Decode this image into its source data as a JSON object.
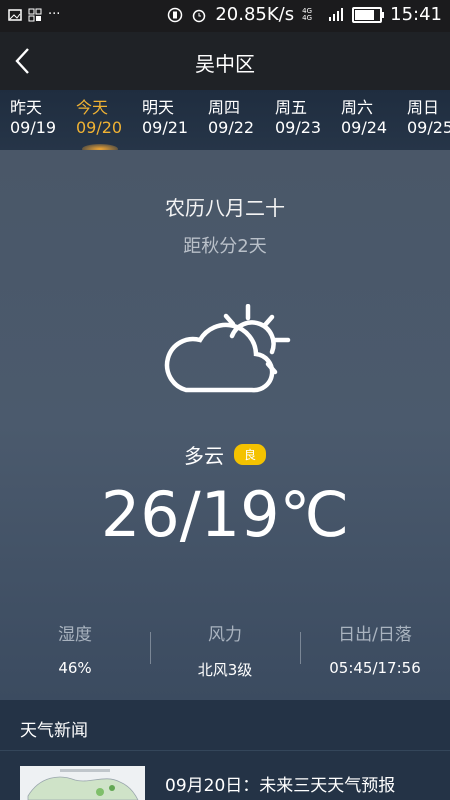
{
  "status_bar": {
    "speed": "20.85K/s",
    "network": "4G 4G",
    "time": "15:41",
    "battery_level": 0.85
  },
  "header": {
    "title": "吴中区"
  },
  "date_strip": {
    "items": [
      {
        "weekday": "昨天",
        "date": "09/19"
      },
      {
        "weekday": "今天",
        "date": "09/20"
      },
      {
        "weekday": "明天",
        "date": "09/21"
      },
      {
        "weekday": "周四",
        "date": "09/22"
      },
      {
        "weekday": "周五",
        "date": "09/23"
      },
      {
        "weekday": "周六",
        "date": "09/24"
      },
      {
        "weekday": "周日",
        "date": "09/25"
      }
    ],
    "active_index": 1
  },
  "weather": {
    "lunar_date": "农历八月二十",
    "solar_term": "距秋分2天",
    "icon": "partly-cloudy-icon",
    "condition": "多云",
    "aqi_label": "良",
    "temperature": "26/19℃"
  },
  "stats": [
    {
      "label": "湿度",
      "value": "46%"
    },
    {
      "label": "风力",
      "value": "北风3级"
    },
    {
      "label": "日出/日落",
      "value": "05:45/17:56"
    }
  ],
  "news": {
    "header": "天气新闻",
    "items": [
      {
        "title": "09月20日：未来三天天气预报"
      }
    ]
  },
  "colors": {
    "accent": "#f0b233",
    "aqi_badge": "#f4c200"
  }
}
